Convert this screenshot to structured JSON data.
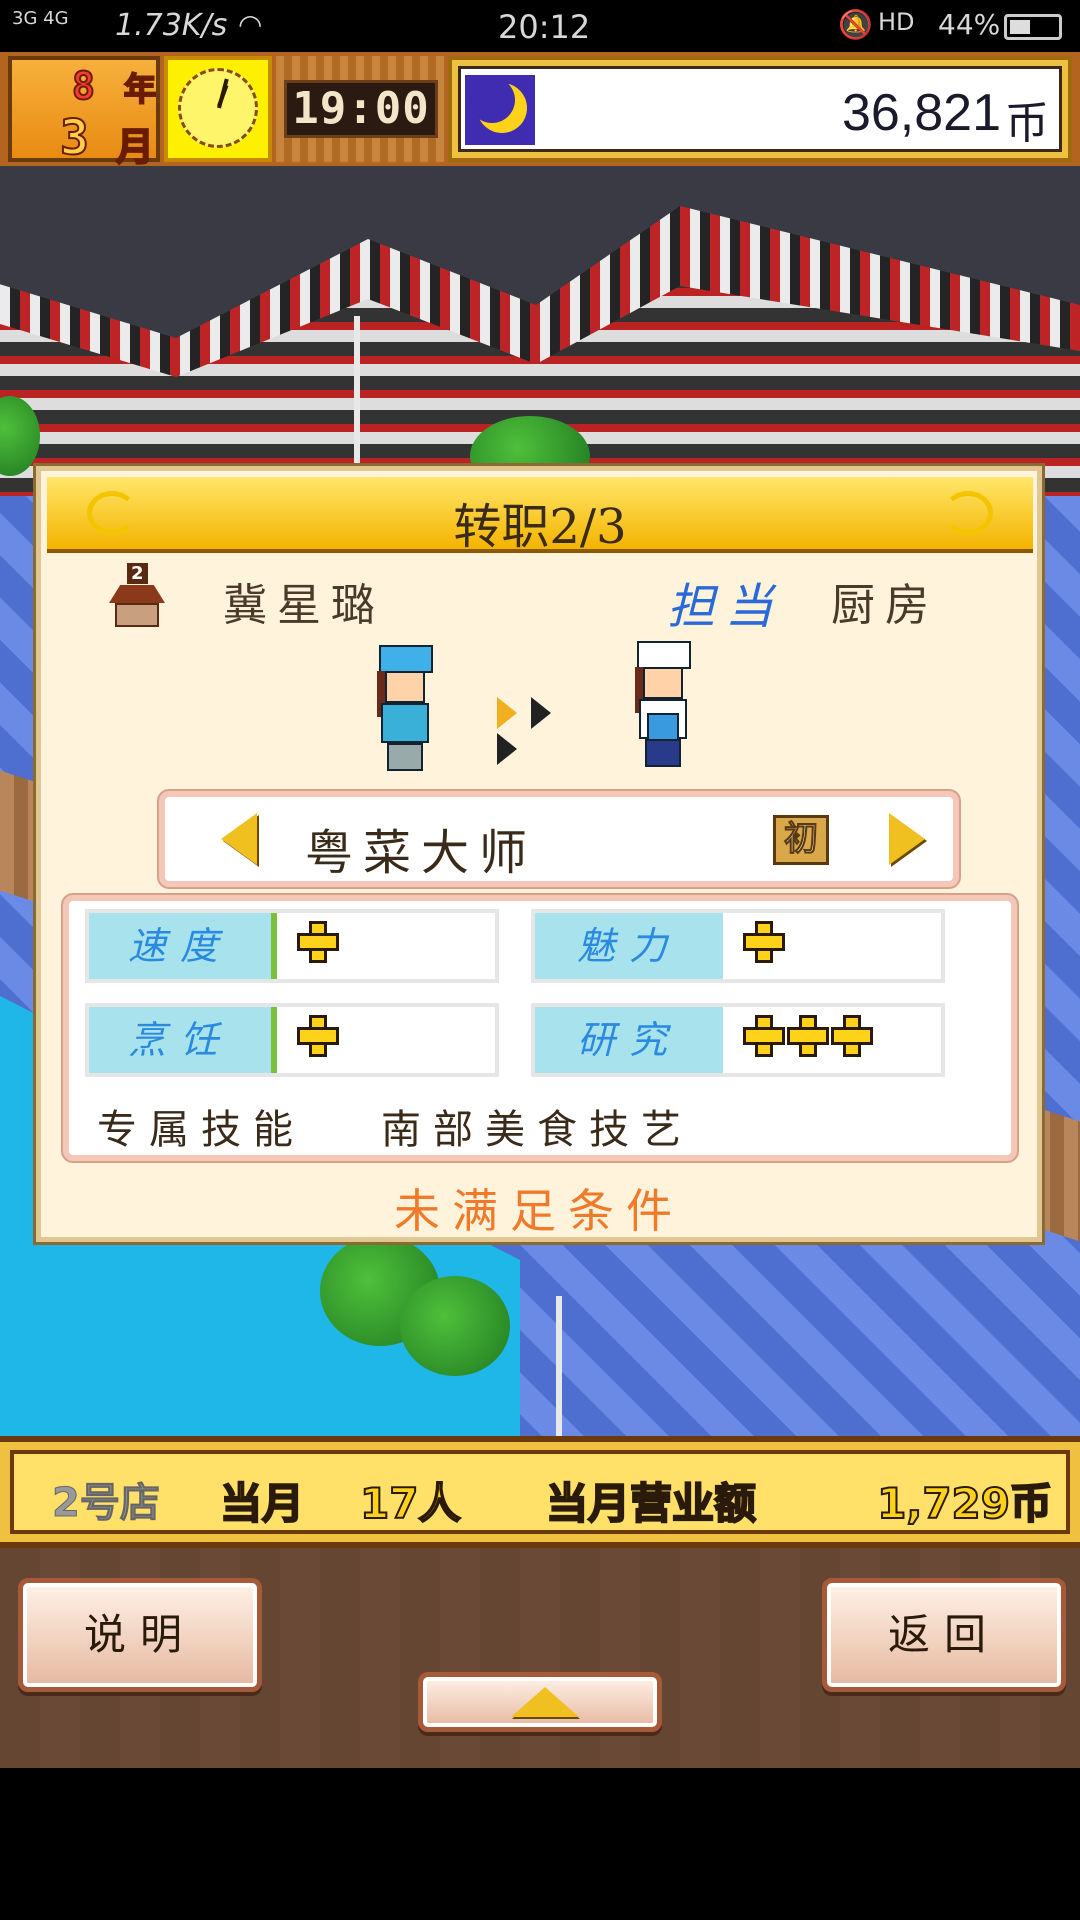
{
  "status_bar": {
    "signal": "3G 4G",
    "speed": "1.73K/s",
    "time": "20:12",
    "hd": "HD",
    "battery": "44%"
  },
  "hud": {
    "year_num": "8",
    "year_unit": "年",
    "month_num": "3",
    "month_unit": "月",
    "clock_time": "19:00",
    "money": "36,821",
    "money_unit": "币"
  },
  "dialog": {
    "title": "转职2/3",
    "shop_number": "2",
    "employee_name": "冀星璐",
    "assign_label": "担当",
    "assign_value": "厨房",
    "job_name": "粤菜大师",
    "job_rank": "初",
    "stats": [
      {
        "label": "速度",
        "plus": 1
      },
      {
        "label": "魅力",
        "plus": 1
      },
      {
        "label": "烹饪",
        "plus": 1
      },
      {
        "label": "研究",
        "plus": 3
      }
    ],
    "skill_label": "专属技能",
    "skill_value": "南部美食技艺",
    "condition": "未满足条件"
  },
  "info_bar": {
    "shop": "2号店",
    "month_label": "当月",
    "customers": "17人",
    "revenue_label": "当月营业额",
    "revenue": "1,729币"
  },
  "buttons": {
    "help": "说明",
    "back": "返回"
  },
  "colors": {
    "accent_gold": "#f0c040",
    "stat_label_bg": "#a8e2ec",
    "stat_label_text": "#2a8ae0",
    "condition_text": "#f07a2a",
    "assign_label": "#2a6ad8"
  }
}
